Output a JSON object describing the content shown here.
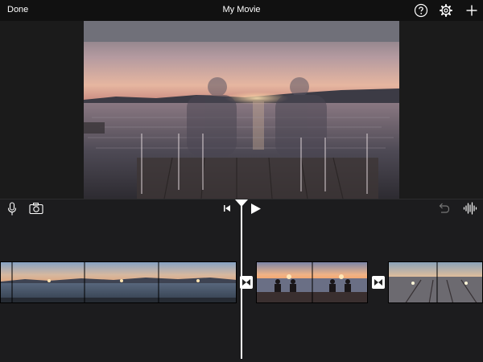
{
  "topbar": {
    "done_label": "Done",
    "title": "My Movie",
    "icons": [
      "help-icon",
      "gear-icon",
      "plus-icon"
    ]
  },
  "toolbar": {
    "icons": [
      "microphone-icon",
      "camera-icon",
      "skip-to-start-icon",
      "play-icon",
      "undo-icon",
      "audio-waveform-icon"
    ]
  },
  "timeline": {
    "clips": [
      "sunset-lake-clip",
      "people-on-dock-clip",
      "dock-sunset-clip"
    ],
    "transitions": [
      "transition-icon",
      "transition-icon"
    ]
  },
  "colors": {
    "topbar": "#111111",
    "background": "#1c1c1e",
    "playhead": "#ffffff",
    "text": "#ffffff"
  }
}
